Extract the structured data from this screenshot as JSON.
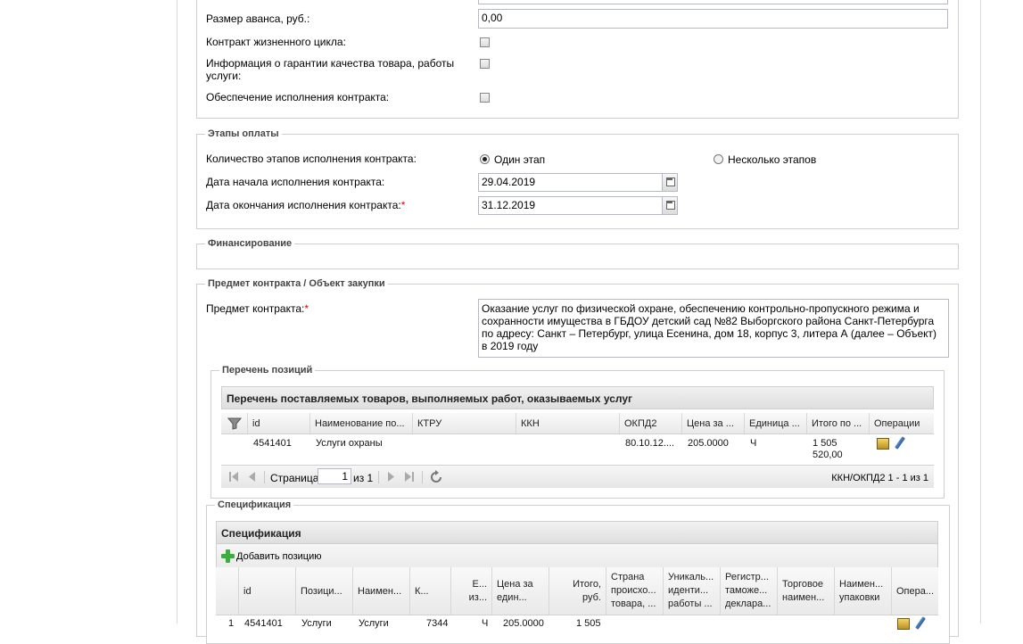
{
  "contract_info": {
    "advance_label": "Размер аванса, руб.:",
    "advance_value": "0,00",
    "lifecycle_label": "Контракт жизненного цикла:",
    "warranty_label": "Информация о гарантии качества товара, работы услуги:",
    "security_label": "Обеспечение исполнения контракта:"
  },
  "payment_stages": {
    "legend": "Этапы оплаты",
    "count_label": "Количество этапов исполнения контракта:",
    "option_one": "Один этап",
    "option_many": "Несколько этапов",
    "start_label": "Дата начала исполнения контракта:",
    "start_value": "29.04.2019",
    "end_label": "Дата окончания исполнения контракта:",
    "end_value": "31.12.2019",
    "required_mark": "*"
  },
  "financing": {
    "legend": "Финансирование"
  },
  "subject": {
    "legend": "Предмет контракта / Объект закупки",
    "label": "Предмет контракта:",
    "required_mark": "*",
    "lines": [
      "Оказание услуг по физической охране, обеспечению контрольно-пропускного режима и",
      "сохранности имущества в ГБДОУ детский сад №82 Выборгского района Санкт-Петербурга",
      "по адресу: Санкт – Петербург, улица Есенина, дом 18, корпус 3, литера А (далее – Объект)",
      "в 2019 году"
    ]
  },
  "positions": {
    "legend": "Перечень позиций",
    "panel_title": "Перечень поставляемых товаров, выполняемых работ, оказываемых услуг",
    "columns": [
      "id",
      "Наименование по...",
      "КТРУ",
      "ККН",
      "ОКПД2",
      "Цена за ...",
      "Единица ...",
      "Итого по ...",
      "Операции"
    ],
    "row": {
      "id": "4541401",
      "name": "Услуги охраны",
      "ktru": "",
      "kkn": "",
      "okpd2": "80.10.12....",
      "price": "205.0000",
      "unit": "Ч",
      "total_line1": "1 505",
      "total_line2": "520,00"
    },
    "pager": {
      "page_label": "Страница",
      "page_value": "1",
      "of_label": "из 1",
      "summary": "ККН/ОКПД2 1 - 1 из 1"
    }
  },
  "specification": {
    "legend": "Спецификация",
    "panel_title": "Спецификация",
    "add_label": "Добавить позицию",
    "columns": [
      "id",
      "Позици...",
      "Наимен...",
      "К...",
      "Е... из...",
      "Цена за един...",
      "Итого, руб.",
      "Страна происхо... товара, ...",
      "Уникаль... иденти... работы ...",
      "Регистр... таможе... деклара...",
      "Торговое наимен...",
      "Наимен... упаковки",
      "Опера..."
    ],
    "row_partial": [
      "1",
      "4541401",
      "Услуги",
      "Услуги",
      "7344",
      "Ч",
      "205.0000",
      "1 505"
    ]
  },
  "colors": {
    "accent_required": "#dd0000",
    "border": "#cfcfcf"
  }
}
